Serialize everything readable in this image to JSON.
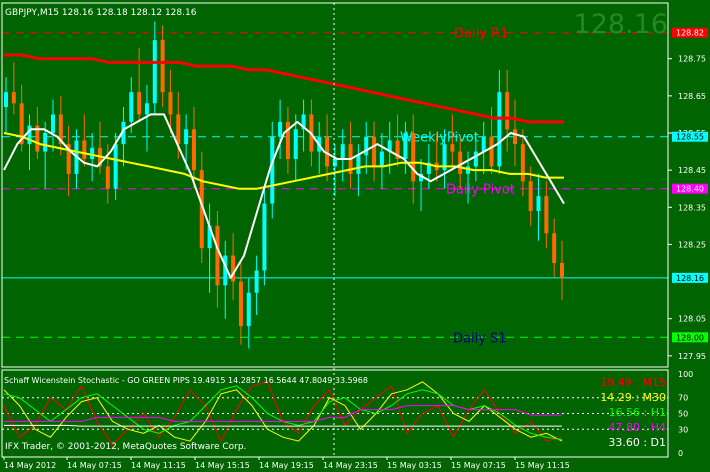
{
  "colors": {
    "background": "#006400",
    "axis_bg": "#000000",
    "grid": "#ffffff",
    "candle_up": "#00ffff",
    "candle_down": "#ff6a00",
    "ma_red": "#ff0000",
    "ma_white": "#ffffff",
    "ma_yellow": "#ffff00",
    "r1_line": "#ff0000",
    "weekly_pivot_line": "#00ffff",
    "daily_pivot_line": "#ff00ff",
    "s1_line": "#00ff00",
    "current_price_line": "#00ffff",
    "big_price_text": "#228b22"
  },
  "chart": {
    "header": "GBPJPY,M15  128.16 128.18 128.12 128.16",
    "big_price": "128.16",
    "price_ticks": [
      "128.75",
      "128.65",
      "128.55",
      "128.45",
      "128.35",
      "128.25",
      "128.05",
      "127.95"
    ],
    "price_range": [
      127.92,
      128.9
    ],
    "levels": [
      {
        "name": "Daily R1",
        "value": 128.82,
        "label_text": "Daily R1",
        "tag": "128.82",
        "color": "#ff0000",
        "text_color": "#ff0000",
        "dash": true
      },
      {
        "name": "WeeklyPivot",
        "value": 128.54,
        "label_text": "WeeklyPivot",
        "tag": "128.55",
        "color": "#00ffff",
        "text_color": "#00ffff",
        "dash": true
      },
      {
        "name": "Daily Pivot",
        "value": 128.4,
        "label_text": "Daily Pivot",
        "tag": "128.40",
        "color": "#ff00ff",
        "text_color": "#ff00ff",
        "dash": true
      },
      {
        "name": "Current",
        "value": 128.16,
        "label_text": "",
        "tag": "128.16",
        "color": "#00ffff",
        "text_color": "#00ffff",
        "dash": false
      },
      {
        "name": "Daily S1",
        "value": 128.0,
        "label_text": "Daily S1",
        "tag": "128.00",
        "color": "#00ff00",
        "text_color": "#000080",
        "dash": true
      }
    ],
    "time_labels": [
      "14 May 2012",
      "14 May 07:15",
      "14 May 11:15",
      "14 May 15:15",
      "14 May 19:15",
      "14 May 23:15",
      "15 May 03:15",
      "15 May 07:15",
      "15 May 11:15"
    ],
    "time_label_unit_positions": [
      0,
      1,
      2,
      3,
      4,
      5,
      6,
      7,
      8
    ],
    "candles": [
      [
        128.62,
        128.7,
        128.55,
        128.66
      ],
      [
        128.66,
        128.74,
        128.6,
        128.63
      ],
      [
        128.63,
        128.68,
        128.5,
        128.52
      ],
      [
        128.52,
        128.6,
        128.45,
        128.57
      ],
      [
        128.57,
        128.62,
        128.48,
        128.5
      ],
      [
        128.5,
        128.58,
        128.4,
        128.55
      ],
      [
        128.55,
        128.64,
        128.5,
        128.6
      ],
      [
        128.6,
        128.65,
        128.49,
        128.52
      ],
      [
        128.52,
        128.57,
        128.38,
        128.44
      ],
      [
        128.44,
        128.56,
        128.4,
        128.53
      ],
      [
        128.53,
        128.6,
        128.46,
        128.48
      ],
      [
        128.48,
        128.55,
        128.42,
        128.51
      ],
      [
        128.51,
        128.58,
        128.44,
        128.46
      ],
      [
        128.46,
        128.52,
        128.36,
        128.4
      ],
      [
        128.4,
        128.55,
        128.37,
        128.52
      ],
      [
        128.52,
        128.62,
        128.46,
        128.58
      ],
      [
        128.58,
        128.7,
        128.55,
        128.66
      ],
      [
        128.66,
        128.78,
        128.58,
        128.6
      ],
      [
        128.6,
        128.68,
        128.5,
        128.63
      ],
      [
        128.63,
        128.85,
        128.6,
        128.8
      ],
      [
        128.8,
        128.84,
        128.62,
        128.66
      ],
      [
        128.66,
        128.72,
        128.55,
        128.6
      ],
      [
        128.6,
        128.66,
        128.48,
        128.52
      ],
      [
        128.52,
        128.6,
        128.45,
        128.56
      ],
      [
        128.56,
        128.62,
        128.4,
        128.45
      ],
      [
        128.45,
        128.5,
        128.2,
        128.24
      ],
      [
        128.24,
        128.36,
        128.12,
        128.3
      ],
      [
        128.3,
        128.34,
        128.08,
        128.14
      ],
      [
        128.14,
        128.26,
        128.05,
        128.22
      ],
      [
        128.22,
        128.28,
        128.1,
        128.15
      ],
      [
        128.15,
        128.2,
        127.98,
        128.03
      ],
      [
        128.03,
        128.16,
        127.97,
        128.12
      ],
      [
        128.12,
        128.22,
        128.06,
        128.18
      ],
      [
        128.18,
        128.4,
        128.14,
        128.36
      ],
      [
        128.36,
        128.58,
        128.32,
        128.54
      ],
      [
        128.54,
        128.64,
        128.48,
        128.58
      ],
      [
        128.58,
        128.62,
        128.44,
        128.48
      ],
      [
        128.48,
        128.6,
        128.42,
        128.56
      ],
      [
        128.56,
        128.64,
        128.5,
        128.6
      ],
      [
        128.6,
        128.64,
        128.46,
        128.5
      ],
      [
        128.5,
        128.58,
        128.44,
        128.54
      ],
      [
        128.54,
        128.6,
        128.42,
        128.46
      ],
      [
        128.46,
        128.52,
        128.38,
        128.48
      ],
      [
        128.48,
        128.56,
        128.42,
        128.52
      ],
      [
        128.52,
        128.58,
        128.4,
        128.44
      ],
      [
        128.44,
        128.52,
        128.38,
        128.49
      ],
      [
        128.49,
        128.58,
        128.44,
        128.54
      ],
      [
        128.54,
        128.58,
        128.42,
        128.46
      ],
      [
        128.46,
        128.55,
        128.4,
        128.5
      ],
      [
        128.5,
        128.58,
        128.44,
        128.53
      ],
      [
        128.53,
        128.6,
        128.46,
        128.48
      ],
      [
        128.48,
        128.58,
        128.44,
        128.55
      ],
      [
        128.55,
        128.6,
        128.36,
        128.42
      ],
      [
        128.42,
        128.48,
        128.34,
        128.44
      ],
      [
        128.44,
        128.52,
        128.4,
        128.47
      ],
      [
        128.47,
        128.55,
        128.42,
        128.45
      ],
      [
        128.45,
        128.56,
        128.4,
        128.52
      ],
      [
        128.52,
        128.6,
        128.46,
        128.5
      ],
      [
        128.5,
        128.54,
        128.4,
        128.44
      ],
      [
        128.44,
        128.5,
        128.36,
        128.46
      ],
      [
        128.46,
        128.55,
        128.42,
        128.5
      ],
      [
        128.5,
        128.58,
        128.44,
        128.54
      ],
      [
        128.54,
        128.62,
        128.44,
        128.46
      ],
      [
        128.46,
        128.72,
        128.44,
        128.66
      ],
      [
        128.66,
        128.72,
        128.5,
        128.56
      ],
      [
        128.56,
        128.64,
        128.46,
        128.52
      ],
      [
        128.52,
        128.56,
        128.38,
        128.42
      ],
      [
        128.42,
        128.46,
        128.3,
        128.34
      ],
      [
        128.34,
        128.44,
        128.26,
        128.38
      ],
      [
        128.38,
        128.42,
        128.24,
        128.28
      ],
      [
        128.28,
        128.32,
        128.16,
        128.2
      ],
      [
        128.2,
        128.26,
        128.1,
        128.16
      ]
    ],
    "ma_red": [
      128.76,
      128.76,
      128.75,
      128.75,
      128.75,
      128.75,
      128.74,
      128.74,
      128.74,
      128.74,
      128.74,
      128.73,
      128.73,
      128.73,
      128.72,
      128.72,
      128.71,
      128.7,
      128.69,
      128.68,
      128.67,
      128.66,
      128.65,
      128.64,
      128.63,
      128.62,
      128.61,
      128.6,
      128.59,
      128.59,
      128.58,
      128.58,
      128.58
    ],
    "ma_white": [
      128.45,
      128.52,
      128.56,
      128.56,
      128.54,
      128.5,
      128.47,
      128.46,
      128.5,
      128.56,
      128.58,
      128.6,
      128.6,
      128.52,
      128.44,
      128.34,
      128.24,
      128.16,
      128.22,
      128.34,
      128.46,
      128.55,
      128.58,
      128.55,
      128.5,
      128.48,
      128.48,
      128.5,
      128.52,
      128.5,
      128.48,
      128.44,
      128.42,
      128.44,
      128.46,
      128.48,
      128.5,
      128.52,
      128.55,
      128.54,
      128.48,
      128.42,
      128.36
    ],
    "ma_yellow": [
      128.55,
      128.54,
      128.52,
      128.51,
      128.5,
      128.49,
      128.48,
      128.47,
      128.46,
      128.45,
      128.44,
      128.42,
      128.41,
      128.4,
      128.4,
      128.41,
      128.42,
      128.43,
      128.44,
      128.45,
      128.46,
      128.46,
      128.47,
      128.47,
      128.46,
      128.46,
      128.45,
      128.45,
      128.44,
      128.44,
      128.43,
      128.43
    ]
  },
  "indicator": {
    "title": "Schaff Wicenstein Stochastic - GO GREEN PIPS 19.4915 14.2857 16.5644 47.8049 33.5968",
    "ticks": [
      "100",
      "70",
      "50",
      "30",
      "0"
    ],
    "readouts": [
      {
        "text": "19.49 : M15",
        "color": "#ff0000"
      },
      {
        "text": "14.29 : M30",
        "color": "#ffff00"
      },
      {
        "text": "16.56 : H1",
        "color": "#00ff00"
      },
      {
        "text": "47.80 : H4",
        "color": "#ff00ff"
      },
      {
        "text": "33.60 : D1",
        "color": "#ffffff"
      }
    ],
    "copyright": "IFX Trader, © 2001-2012, MetaQuotes Software Corp.",
    "series": [
      {
        "name": "M15",
        "color": "#ff0000",
        "values": [
          60,
          20,
          35,
          70,
          55,
          85,
          40,
          10,
          30,
          50,
          20,
          45,
          80,
          60,
          15,
          55,
          85,
          90,
          40,
          25,
          60,
          80,
          35,
          55,
          70,
          85,
          25,
          50,
          60,
          20,
          55,
          80,
          50,
          25,
          40,
          15,
          20
        ]
      },
      {
        "name": "M30",
        "color": "#ffff00",
        "values": [
          80,
          60,
          30,
          20,
          45,
          65,
          70,
          40,
          30,
          25,
          35,
          20,
          15,
          40,
          75,
          80,
          60,
          30,
          20,
          15,
          35,
          70,
          60,
          30,
          50,
          75,
          80,
          90,
          75,
          50,
          40,
          60,
          45,
          30,
          20,
          25,
          15
        ]
      },
      {
        "name": "H1",
        "color": "#00ff00",
        "values": [
          75,
          70,
          55,
          40,
          55,
          70,
          75,
          60,
          45,
          30,
          25,
          35,
          40,
          60,
          80,
          85,
          70,
          50,
          40,
          35,
          40,
          65,
          70,
          55,
          50,
          60,
          75,
          80,
          75,
          60,
          55,
          60,
          50,
          35,
          25,
          20,
          17
        ]
      },
      {
        "name": "H4",
        "color": "#ff00ff",
        "values": [
          40,
          40,
          40,
          40,
          40,
          40,
          45,
          45,
          45,
          45,
          45,
          40,
          40,
          40,
          40,
          40,
          40,
          40,
          40,
          40,
          40,
          45,
          45,
          55,
          55,
          55,
          60,
          60,
          60,
          60,
          55,
          55,
          55,
          55,
          48,
          48,
          48
        ]
      },
      {
        "name": "D1",
        "color": "#ffffff",
        "values": [
          35,
          35,
          35,
          35,
          35,
          34,
          34,
          34,
          34,
          34,
          34,
          34,
          34,
          34,
          34,
          34,
          34,
          34,
          34,
          34,
          34,
          34,
          34,
          34,
          34,
          34,
          34,
          34,
          34,
          34,
          34,
          34,
          34,
          34,
          34,
          34,
          34
        ]
      }
    ]
  }
}
